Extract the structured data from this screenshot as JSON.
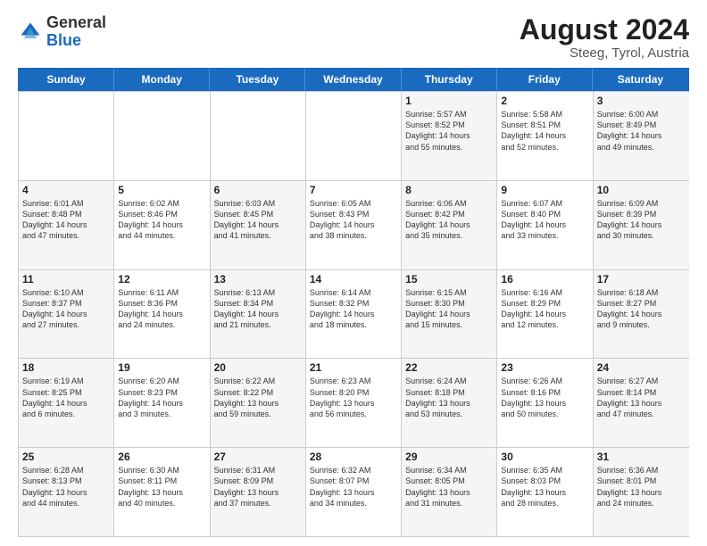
{
  "header": {
    "logo_general": "General",
    "logo_blue": "Blue",
    "month_year": "August 2024",
    "location": "Steeg, Tyrol, Austria"
  },
  "weekdays": [
    "Sunday",
    "Monday",
    "Tuesday",
    "Wednesday",
    "Thursday",
    "Friday",
    "Saturday"
  ],
  "weeks": [
    [
      {
        "day": "",
        "info": ""
      },
      {
        "day": "",
        "info": ""
      },
      {
        "day": "",
        "info": ""
      },
      {
        "day": "",
        "info": ""
      },
      {
        "day": "1",
        "info": "Sunrise: 5:57 AM\nSunset: 8:52 PM\nDaylight: 14 hours\nand 55 minutes."
      },
      {
        "day": "2",
        "info": "Sunrise: 5:58 AM\nSunset: 8:51 PM\nDaylight: 14 hours\nand 52 minutes."
      },
      {
        "day": "3",
        "info": "Sunrise: 6:00 AM\nSunset: 8:49 PM\nDaylight: 14 hours\nand 49 minutes."
      }
    ],
    [
      {
        "day": "4",
        "info": "Sunrise: 6:01 AM\nSunset: 8:48 PM\nDaylight: 14 hours\nand 47 minutes."
      },
      {
        "day": "5",
        "info": "Sunrise: 6:02 AM\nSunset: 8:46 PM\nDaylight: 14 hours\nand 44 minutes."
      },
      {
        "day": "6",
        "info": "Sunrise: 6:03 AM\nSunset: 8:45 PM\nDaylight: 14 hours\nand 41 minutes."
      },
      {
        "day": "7",
        "info": "Sunrise: 6:05 AM\nSunset: 8:43 PM\nDaylight: 14 hours\nand 38 minutes."
      },
      {
        "day": "8",
        "info": "Sunrise: 6:06 AM\nSunset: 8:42 PM\nDaylight: 14 hours\nand 35 minutes."
      },
      {
        "day": "9",
        "info": "Sunrise: 6:07 AM\nSunset: 8:40 PM\nDaylight: 14 hours\nand 33 minutes."
      },
      {
        "day": "10",
        "info": "Sunrise: 6:09 AM\nSunset: 8:39 PM\nDaylight: 14 hours\nand 30 minutes."
      }
    ],
    [
      {
        "day": "11",
        "info": "Sunrise: 6:10 AM\nSunset: 8:37 PM\nDaylight: 14 hours\nand 27 minutes."
      },
      {
        "day": "12",
        "info": "Sunrise: 6:11 AM\nSunset: 8:36 PM\nDaylight: 14 hours\nand 24 minutes."
      },
      {
        "day": "13",
        "info": "Sunrise: 6:13 AM\nSunset: 8:34 PM\nDaylight: 14 hours\nand 21 minutes."
      },
      {
        "day": "14",
        "info": "Sunrise: 6:14 AM\nSunset: 8:32 PM\nDaylight: 14 hours\nand 18 minutes."
      },
      {
        "day": "15",
        "info": "Sunrise: 6:15 AM\nSunset: 8:30 PM\nDaylight: 14 hours\nand 15 minutes."
      },
      {
        "day": "16",
        "info": "Sunrise: 6:16 AM\nSunset: 8:29 PM\nDaylight: 14 hours\nand 12 minutes."
      },
      {
        "day": "17",
        "info": "Sunrise: 6:18 AM\nSunset: 8:27 PM\nDaylight: 14 hours\nand 9 minutes."
      }
    ],
    [
      {
        "day": "18",
        "info": "Sunrise: 6:19 AM\nSunset: 8:25 PM\nDaylight: 14 hours\nand 6 minutes."
      },
      {
        "day": "19",
        "info": "Sunrise: 6:20 AM\nSunset: 8:23 PM\nDaylight: 14 hours\nand 3 minutes."
      },
      {
        "day": "20",
        "info": "Sunrise: 6:22 AM\nSunset: 8:22 PM\nDaylight: 13 hours\nand 59 minutes."
      },
      {
        "day": "21",
        "info": "Sunrise: 6:23 AM\nSunset: 8:20 PM\nDaylight: 13 hours\nand 56 minutes."
      },
      {
        "day": "22",
        "info": "Sunrise: 6:24 AM\nSunset: 8:18 PM\nDaylight: 13 hours\nand 53 minutes."
      },
      {
        "day": "23",
        "info": "Sunrise: 6:26 AM\nSunset: 8:16 PM\nDaylight: 13 hours\nand 50 minutes."
      },
      {
        "day": "24",
        "info": "Sunrise: 6:27 AM\nSunset: 8:14 PM\nDaylight: 13 hours\nand 47 minutes."
      }
    ],
    [
      {
        "day": "25",
        "info": "Sunrise: 6:28 AM\nSunset: 8:13 PM\nDaylight: 13 hours\nand 44 minutes."
      },
      {
        "day": "26",
        "info": "Sunrise: 6:30 AM\nSunset: 8:11 PM\nDaylight: 13 hours\nand 40 minutes."
      },
      {
        "day": "27",
        "info": "Sunrise: 6:31 AM\nSunset: 8:09 PM\nDaylight: 13 hours\nand 37 minutes."
      },
      {
        "day": "28",
        "info": "Sunrise: 6:32 AM\nSunset: 8:07 PM\nDaylight: 13 hours\nand 34 minutes."
      },
      {
        "day": "29",
        "info": "Sunrise: 6:34 AM\nSunset: 8:05 PM\nDaylight: 13 hours\nand 31 minutes."
      },
      {
        "day": "30",
        "info": "Sunrise: 6:35 AM\nSunset: 8:03 PM\nDaylight: 13 hours\nand 28 minutes."
      },
      {
        "day": "31",
        "info": "Sunrise: 6:36 AM\nSunset: 8:01 PM\nDaylight: 13 hours\nand 24 minutes."
      }
    ]
  ]
}
